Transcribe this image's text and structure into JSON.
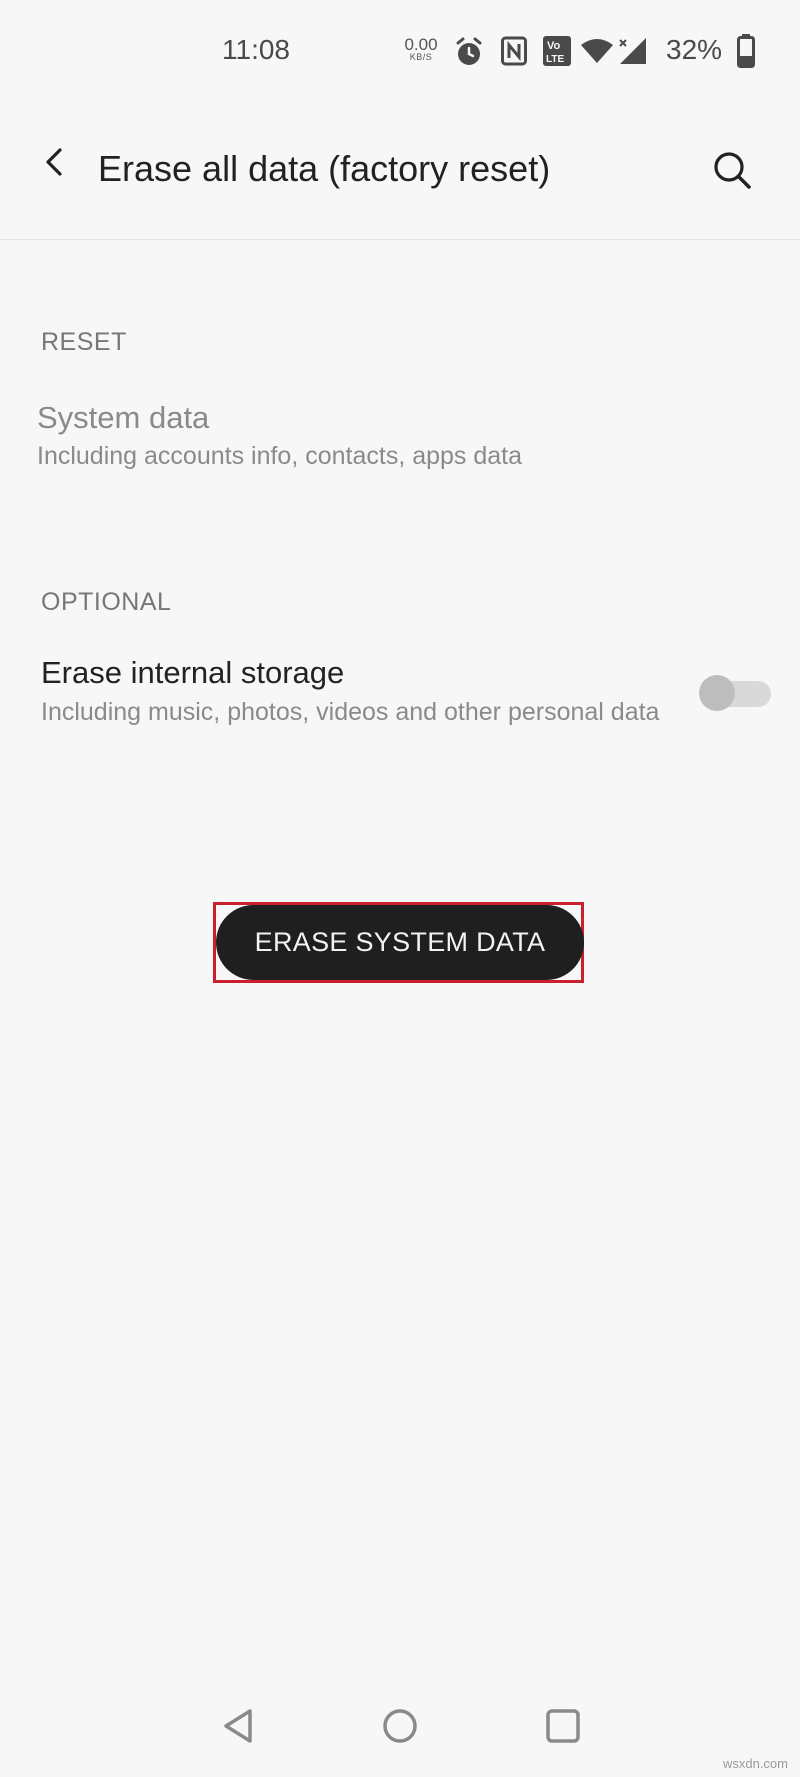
{
  "status_bar": {
    "time": "11:08",
    "net_speed_value": "0.00",
    "net_speed_unit": "KB/S",
    "battery_percent": "32%",
    "icons": [
      "alarm-icon",
      "nfc-icon",
      "volte-icon",
      "wifi-icon",
      "signal-icon",
      "battery-icon"
    ],
    "volte_label_top": "Vo",
    "volte_label_bottom": "LTE"
  },
  "app_bar": {
    "title": "Erase all data (factory reset)",
    "back_icon": "chevron-left-icon",
    "search_icon": "search-icon"
  },
  "sections": {
    "reset": {
      "header": "RESET",
      "item_title": "System data",
      "item_summary": "Including accounts info, contacts, apps data"
    },
    "optional": {
      "header": "OPTIONAL",
      "item_title": "Erase internal storage",
      "item_summary": "Including music, photos, videos and other personal data",
      "toggle_on": false
    }
  },
  "action": {
    "erase_label": "ERASE SYSTEM DATA",
    "highlight_color": "#c8202c"
  },
  "nav_bar": {
    "icons": [
      "back-triangle-icon",
      "home-circle-icon",
      "recents-square-icon"
    ]
  },
  "watermark": "wsxdn.com"
}
